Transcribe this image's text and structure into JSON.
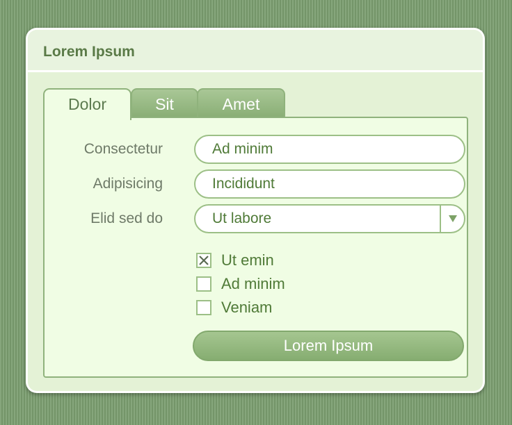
{
  "window": {
    "title": "Lorem Ipsum"
  },
  "tabs": [
    {
      "label": "Dolor",
      "active": true
    },
    {
      "label": "Sit",
      "active": false
    },
    {
      "label": "Amet",
      "active": false
    }
  ],
  "form": {
    "fields": [
      {
        "label": "Consectetur",
        "value": "Ad minim"
      },
      {
        "label": "Adipisicing",
        "value": "Incididunt"
      }
    ],
    "select": {
      "label": "Elid sed do",
      "value": "Ut labore"
    },
    "checkboxes": [
      {
        "label": "Ut emin",
        "checked": true
      },
      {
        "label": "Ad minim",
        "checked": false
      },
      {
        "label": "Veniam",
        "checked": false
      }
    ],
    "submit_label": "Lorem Ipsum"
  },
  "icons": {
    "select_arrow": "triangle-down-icon",
    "checkbox_checked": "x-mark-icon"
  },
  "colors": {
    "accent": "#88ad74",
    "title": "#5a7a47",
    "text": "#4f7a37",
    "label": "#6e7a68",
    "background": "#7d9e73"
  }
}
